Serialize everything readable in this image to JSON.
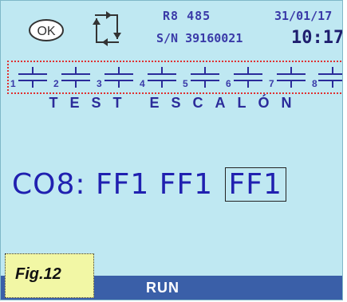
{
  "header": {
    "ok_label": "OK",
    "model": "R8 485",
    "serial": "S/N 39160021",
    "date": "31/01/17",
    "time": "10:17"
  },
  "steps": [
    "1",
    "2",
    "3",
    "4",
    "5",
    "6",
    "7",
    "8"
  ],
  "title": "TEST ESCALÓN",
  "reading": {
    "prefix": "CO8:",
    "values": [
      "FF1",
      "FF1",
      "FF1"
    ]
  },
  "status": "RUN",
  "figure_label": "Fig.12",
  "colors": {
    "screen_bg": "#bfe8f2",
    "text_blue": "#3a3aa8",
    "status_bar": "#3a5fa8",
    "highlight": "#e03030"
  },
  "icons": {
    "ok": "ok-circle-icon",
    "cycle": "cycle-arrows-icon",
    "capacitor": "capacitor-icon"
  }
}
